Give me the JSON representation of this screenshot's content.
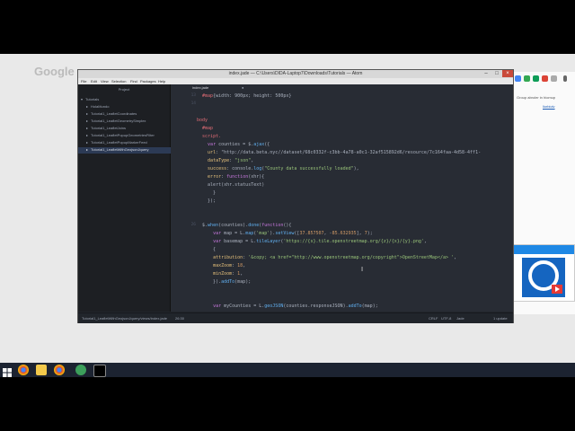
{
  "browser": {
    "logo": "Google",
    "right_panel_text": "Group abroler in hiomup",
    "right_panel_link": "liorbiolv"
  },
  "atom": {
    "title": "index.jade — C:\\Users\\DIDA-Laptop7\\Downloads\\Tutorials — Atom",
    "menu": [
      "File",
      "Edit",
      "View",
      "Selection",
      "Find",
      "Packages",
      "Help"
    ],
    "tree_header": "Project",
    "tree": [
      {
        "label": "Tutorials",
        "expanded": true,
        "selected": false,
        "depth": 0
      },
      {
        "label": "HolaMundo",
        "expanded": false,
        "selected": false,
        "depth": 1
      },
      {
        "label": "Tutorial1_LeafletCoordinates",
        "expanded": false,
        "selected": false,
        "depth": 1
      },
      {
        "label": "Tutorial1_LeafletGeometrySimplex",
        "expanded": false,
        "selected": false,
        "depth": 1
      },
      {
        "label": "Tutorial1_LeafletJoins",
        "expanded": false,
        "selected": false,
        "depth": 1
      },
      {
        "label": "Tutorial1_LeafletPopupGeometriesFilter",
        "expanded": false,
        "selected": false,
        "depth": 1
      },
      {
        "label": "Tutorial1_LeafletPopupMarkerFeed",
        "expanded": false,
        "selected": false,
        "depth": 1
      },
      {
        "label": "Tutorial1_LeafletWithGeojsonJquery",
        "expanded": false,
        "selected": true,
        "depth": 1
      }
    ],
    "tab_label": "index.jade",
    "line_numbers": [
      "13",
      "14",
      "",
      "",
      "",
      "",
      "",
      "",
      "",
      "",
      "",
      "",
      "",
      "",
      "",
      "",
      "26",
      "",
      "",
      "",
      "",
      "",
      "",
      "",
      "",
      "",
      "",
      "",
      ""
    ],
    "code_lines": [
      "  #map{width: 900px; height: 500px}",
      "",
      "",
      "body",
      "  #map",
      "  script.",
      "    var counties = $.ajax({",
      "    url: \"http://data.beta.nyc//dataset/68c0332f-c3bb-4a78-a0c1-32af515892d6/resource/7c164faa-4d58-4ff1-",
      "    dataType: \"json\",",
      "    success: console.log(\"County data successfully loaded\"),",
      "    error: function(xhr){",
      "    alert(xhr.statusText)",
      "      }",
      "    });",
      "",
      "",
      "  $.when(counties).done(function(){",
      "      var map = L.map('map').setView([37.857507, -85.632935], 7);",
      "      var basemap = L.tileLayer('https://{s}.tile.openstreetmap.org/{z}/{x}/{y}.png',",
      "      {",
      "      attribution: '&copy; <a href=\"http://www.openstreetmap.org/copyright\">OpenStreetMap</a> ',",
      "      maxZoom: 18,",
      "      minZoom: 1,",
      "      }).addTo(map);",
      "",
      "",
      "      var myCounties = L.geoJSON(counties.responseJSON).addTo(map);",
      "    });",
      ""
    ],
    "status_left": "Tutorial1_LeafletWithGeojsonJquery/views/index.jade",
    "status_pos": "26:30",
    "status_right": [
      "CRLF",
      "UTF-8",
      "Jade",
      "1 update"
    ]
  }
}
